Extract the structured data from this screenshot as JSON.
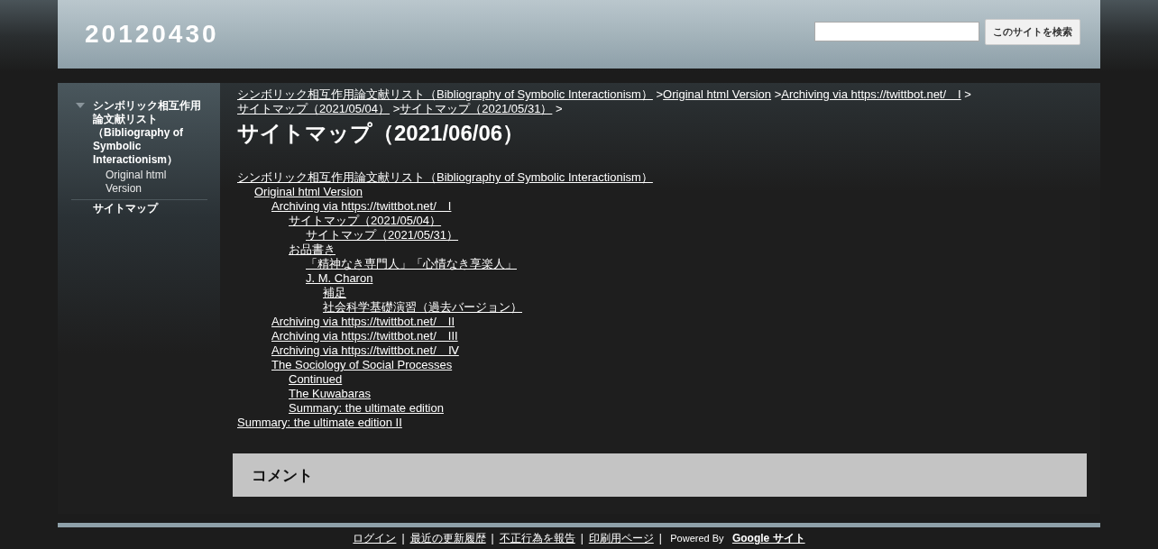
{
  "site_title": "20120430",
  "search": {
    "button": "このサイトを検索"
  },
  "sidebar": {
    "items": [
      {
        "label": "シンボリック相互作用論文献リスト（Bibliography of Symbolic Interactionism）",
        "expanded": true,
        "children": [
          {
            "label": "Original html Version"
          }
        ]
      },
      {
        "label": "サイトマップ"
      }
    ]
  },
  "breadcrumb": [
    {
      "label": "シンボリック相互作用論文献リスト（Bibliography of Symbolic Interactionism）",
      "separator": ">"
    },
    {
      "label": "Original html Version",
      "separator": ">"
    },
    {
      "label": "Archiving via https://twittbot.net/　I",
      "separator": ">"
    },
    {
      "label": "サイトマップ（2021/05/04）",
      "separator": ">"
    },
    {
      "label": "サイトマップ（2021/05/31）",
      "separator": ">"
    }
  ],
  "page_title": "サイトマップ（2021/06/06）",
  "tree": [
    {
      "label": "シンボリック相互作用論文献リスト（Bibliography of Symbolic Interactionism）",
      "children": [
        {
          "label": "Original html Version",
          "children": [
            {
              "label": "Archiving via https://twittbot.net/　I",
              "children": [
                {
                  "label": "サイトマップ（2021/05/04）",
                  "children": [
                    {
                      "label": "サイトマップ（2021/05/31）"
                    }
                  ]
                },
                {
                  "label": "お品書き",
                  "children": [
                    {
                      "label": "「精神なき専門人」「心情なき享楽人」"
                    },
                    {
                      "label": "J. M. Charon",
                      "children": [
                        {
                          "label": "補足"
                        },
                        {
                          "label": "社会科学基礎演習（過去バージョン）"
                        }
                      ]
                    }
                  ]
                }
              ]
            },
            {
              "label": "Archiving via https://twittbot.net/　II"
            },
            {
              "label": "Archiving via https://twittbot.net/　III"
            },
            {
              "label": "Archiving via https://twittbot.net/　Ⅳ"
            },
            {
              "label": "The Sociology of Social Processes",
              "children": [
                {
                  "label": "Continued"
                },
                {
                  "label": "The Kuwabaras"
                },
                {
                  "label": "Summary: the ultimate edition"
                }
              ]
            }
          ]
        }
      ]
    },
    {
      "label": "Summary: the ultimate edition II"
    }
  ],
  "comments_heading": "コメント",
  "footer": {
    "links": [
      {
        "label": "ログイン",
        "separator": "|"
      },
      {
        "label": "最近の更新履歴",
        "separator": "|"
      },
      {
        "label": "不正行為を報告",
        "separator": "|"
      },
      {
        "label": "印刷用ページ",
        "separator": "|"
      }
    ],
    "powered_by": "Powered By",
    "brand": "Google サイト"
  }
}
